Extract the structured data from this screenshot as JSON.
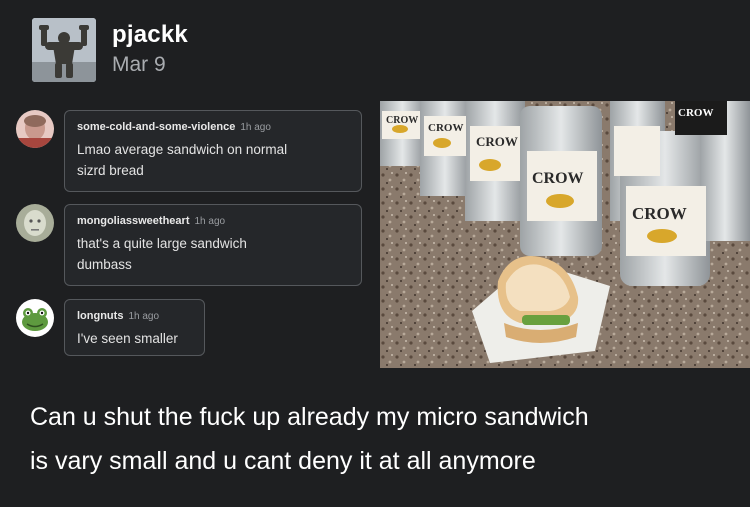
{
  "post": {
    "username": "pjackk",
    "date": "Mar 9",
    "avatar_icon": "bodybuilder-statue-avatar"
  },
  "comments": [
    {
      "username": "some-cold-and-some-violence",
      "time": "1h ago",
      "text_line1": "Lmao average sandwich on normal",
      "text_line2": "sizrd bread",
      "avatar_icon": "portrait-avatar"
    },
    {
      "username": "mongoliassweetheart",
      "time": "1h ago",
      "text_line1": "that's a quite large sandwich",
      "text_line2": "dumbass",
      "avatar_icon": "grey-face-avatar"
    },
    {
      "username": "longnuts",
      "time": "1h ago",
      "text_line1": "I've seen smaller",
      "avatar_icon": "frog-avatar"
    }
  ],
  "photo": {
    "bottle_label_text": [
      "CROW",
      "CROW",
      "CROW",
      "CROW",
      "CROW",
      "CROW"
    ],
    "subject": "sandwich-on-napkin"
  },
  "caption": {
    "line1": "Can u shut the fuck up already my micro sandwich",
    "line2": "is vary small and u cant deny it at all anymore"
  },
  "colors": {
    "background": "#1e1f21",
    "bubble_border": "#55585c",
    "muted_text": "#9a9da1"
  }
}
